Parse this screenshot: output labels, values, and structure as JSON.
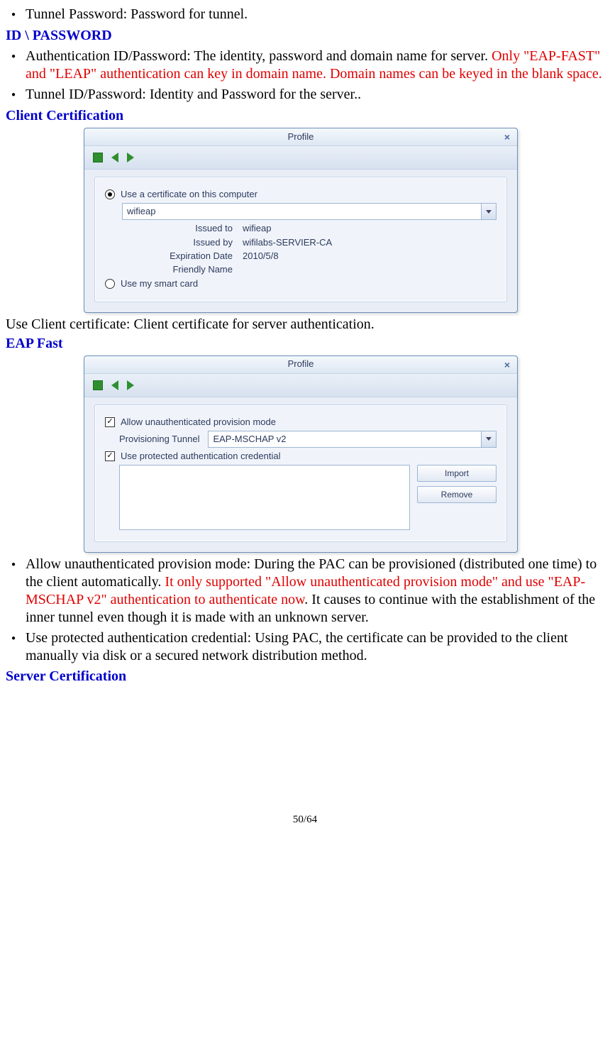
{
  "item0": "Tunnel Password: Password for tunnel.",
  "h1": "ID \\ PASSWORD",
  "item1a": "Authentication ID/Password: The identity, password and domain name for server. ",
  "item1b": "Only \"EAP-FAST\" and \"LEAP\" authentication can key in domain name. Domain names can be keyed in the blank space.",
  "item2": "Tunnel ID/Password: Identity and Password for the server..",
  "h2": "Client Certification",
  "fig1": {
    "title": "Profile",
    "radio1": "Use a certificate on this computer",
    "dd": "wifieap",
    "issued_to_k": "Issued to",
    "issued_to_v": "wifieap",
    "issued_by_k": "Issued by",
    "issued_by_v": "wifilabs-SERVIER-CA",
    "exp_k": "Expiration Date",
    "exp_v": "2010/5/8",
    "fn_k": "Friendly Name",
    "radio2": "Use my smart card"
  },
  "para1": "Use Client certificate:   Client certificate for server authentication.",
  "h3": "EAP Fast",
  "fig2": {
    "title": "Profile",
    "chk1": "Allow unauthenticated provision mode",
    "pt_label": "Provisioning Tunnel",
    "pt_value": "EAP-MSCHAP v2",
    "chk2": "Use protected authentication credential",
    "btn_import": "Import",
    "btn_remove": "Remove"
  },
  "item3a": "Allow unauthenticated provision mode: During the PAC can be provisioned (distributed one time) to the client automatically. ",
  "item3b": "It only supported \"Allow unauthenticated provision mode\" and use \"EAP-MSCHAP v2\" authentication to authenticate now",
  "item3c": ". It causes to continue with the establishment of the inner tunnel even though it is made with an unknown server.",
  "item4": "Use protected authentication credential: Using PAC, the certificate can be provided to the client manually via disk or a secured network distribution method.",
  "h4": "Server Certification",
  "footer": "50/64"
}
